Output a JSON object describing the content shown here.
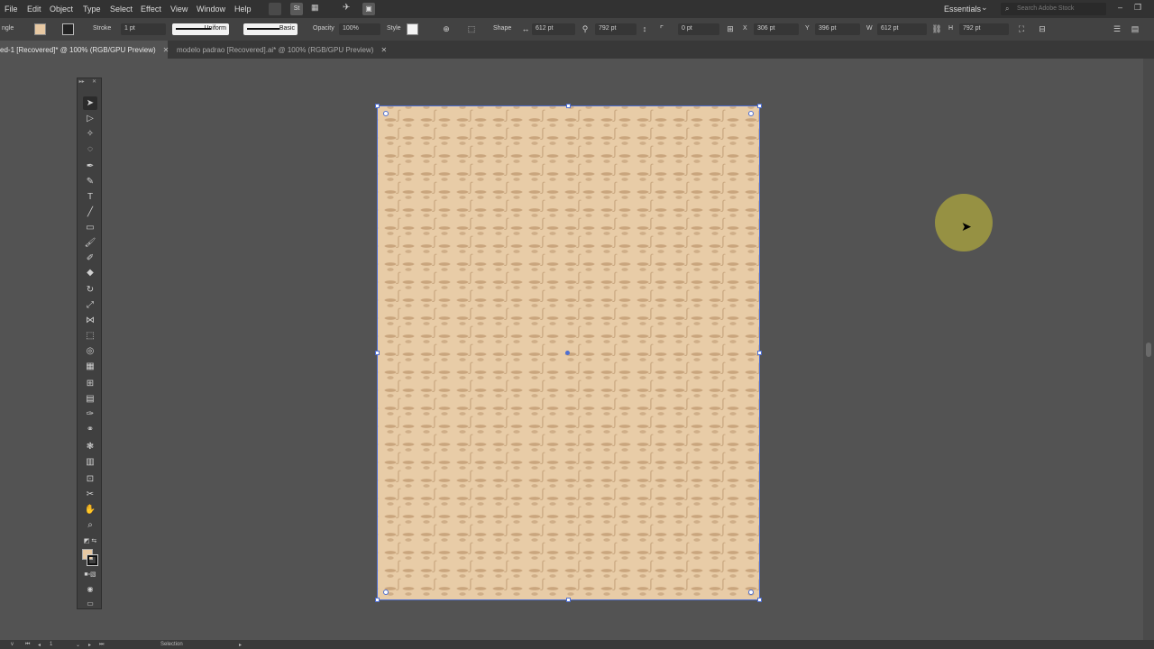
{
  "menu": {
    "items": [
      "File",
      "Edit",
      "Object",
      "Type",
      "Select",
      "Effect",
      "View",
      "Window",
      "Help"
    ],
    "workspace": "Essentials",
    "search_placeholder": "Search Adobe Stock"
  },
  "control": {
    "tool_name": "ngle",
    "fill_color": "#e8c9a3",
    "stroke_label": "Stroke",
    "stroke_weight": "1 pt",
    "profile_label": "Uniform",
    "brush_label": "Basic",
    "opacity_label": "Opacity",
    "opacity_value": "100%",
    "style_label": "Style",
    "shape_label": "Shape",
    "shape_w": "612 pt",
    "shape_h": "792 pt",
    "corner_value": "0 pt",
    "x_label": "X",
    "x_value": "306 pt",
    "y_label": "Y",
    "y_value": "396 pt",
    "w_label": "W",
    "w_value": "612 pt",
    "h_label": "H",
    "h_value": "792 pt"
  },
  "tabs": [
    {
      "label": "ed-1 [Recovered]* @ 100% (RGB/GPU Preview)"
    },
    {
      "label": "modelo padrao [Recovered].ai* @ 100% (RGB/GPU Preview)"
    }
  ],
  "status": {
    "zoom": "v",
    "page": "1",
    "tool": "Selection"
  },
  "colors": {
    "artboard": "#e8cca7",
    "selection": "#4f6fd1"
  }
}
